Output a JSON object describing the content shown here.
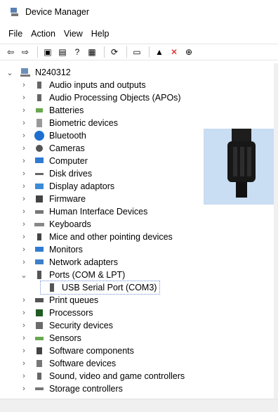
{
  "window": {
    "title": "Device Manager"
  },
  "menu": [
    "File",
    "Action",
    "View",
    "Help"
  ],
  "toolbar": [
    "back-icon",
    "forward-icon",
    "properties-icon",
    "list-icon",
    "help-icon",
    "view-icon",
    "scan-icon",
    "monitor-icon",
    "add-driver-icon",
    "uninstall-icon",
    "update-icon"
  ],
  "tree": {
    "root": "N240312",
    "items": [
      {
        "label": "Audio inputs and outputs",
        "icon": "speaker-icon"
      },
      {
        "label": "Audio Processing Objects (APOs)",
        "icon": "speaker-icon"
      },
      {
        "label": "Batteries",
        "icon": "battery-icon"
      },
      {
        "label": "Biometric devices",
        "icon": "fingerprint-icon"
      },
      {
        "label": "Bluetooth",
        "icon": "bluetooth-icon"
      },
      {
        "label": "Cameras",
        "icon": "camera-icon"
      },
      {
        "label": "Computer",
        "icon": "monitor-icon"
      },
      {
        "label": "Disk drives",
        "icon": "disk-icon"
      },
      {
        "label": "Display adaptors",
        "icon": "display-icon"
      },
      {
        "label": "Firmware",
        "icon": "firmware-icon"
      },
      {
        "label": "Human Interface Devices",
        "icon": "hid-icon"
      },
      {
        "label": "Keyboards",
        "icon": "keyboard-icon"
      },
      {
        "label": "Mice and other pointing devices",
        "icon": "mouse-icon"
      },
      {
        "label": "Monitors",
        "icon": "monitor-icon"
      },
      {
        "label": "Network adapters",
        "icon": "network-icon"
      },
      {
        "label": "Ports (COM & LPT)",
        "icon": "port-icon",
        "expanded": true,
        "children": [
          {
            "label": "USB Serial Port (COM3)",
            "icon": "port-icon",
            "selected": true
          }
        ]
      },
      {
        "label": "Print queues",
        "icon": "printer-icon"
      },
      {
        "label": "Processors",
        "icon": "cpu-icon"
      },
      {
        "label": "Security devices",
        "icon": "security-icon"
      },
      {
        "label": "Sensors",
        "icon": "sensor-icon"
      },
      {
        "label": "Software components",
        "icon": "software-icon"
      },
      {
        "label": "Software devices",
        "icon": "software-device-icon"
      },
      {
        "label": "Sound, video and game controllers",
        "icon": "speaker-icon"
      },
      {
        "label": "Storage controllers",
        "icon": "storage-icon"
      }
    ]
  }
}
